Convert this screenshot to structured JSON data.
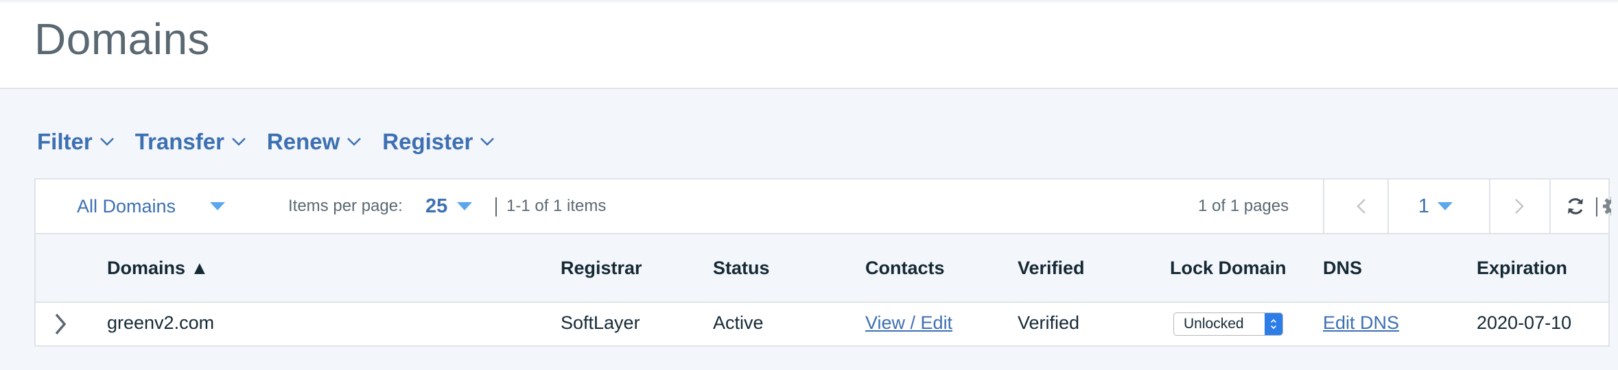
{
  "page": {
    "title": "Domains"
  },
  "actions": [
    {
      "label": "Filter"
    },
    {
      "label": "Transfer"
    },
    {
      "label": "Renew"
    },
    {
      "label": "Register"
    }
  ],
  "toolbar": {
    "domain_filter": "All Domains",
    "items_per_page_label": "Items per page:",
    "items_per_page_value": "25",
    "range_text": "1-1 of 1 items",
    "pages_text": "1 of 1 pages",
    "current_page": "1"
  },
  "table": {
    "columns": [
      "Domains ▲",
      "Registrar",
      "Status",
      "Contacts",
      "Verified",
      "Lock Domain",
      "DNS",
      "Expiration"
    ],
    "rows": [
      {
        "domain": "greenv2.com",
        "registrar": "SoftLayer",
        "status": "Active",
        "contacts": "View / Edit",
        "verified": "Verified",
        "lock": "Unlocked",
        "dns": "Edit DNS",
        "expiration": "2020-07-10"
      }
    ]
  },
  "colors": {
    "accent": "#3d70b2",
    "dropdown_arrow": "#5aa7ec",
    "text": "#152935",
    "muted": "#5a6872",
    "background": "#f3f6fa"
  },
  "icons": [
    "chevron-down-icon",
    "chevron-left-icon",
    "chevron-right-icon",
    "refresh-icon",
    "gear-icon",
    "expand-row-icon"
  ]
}
